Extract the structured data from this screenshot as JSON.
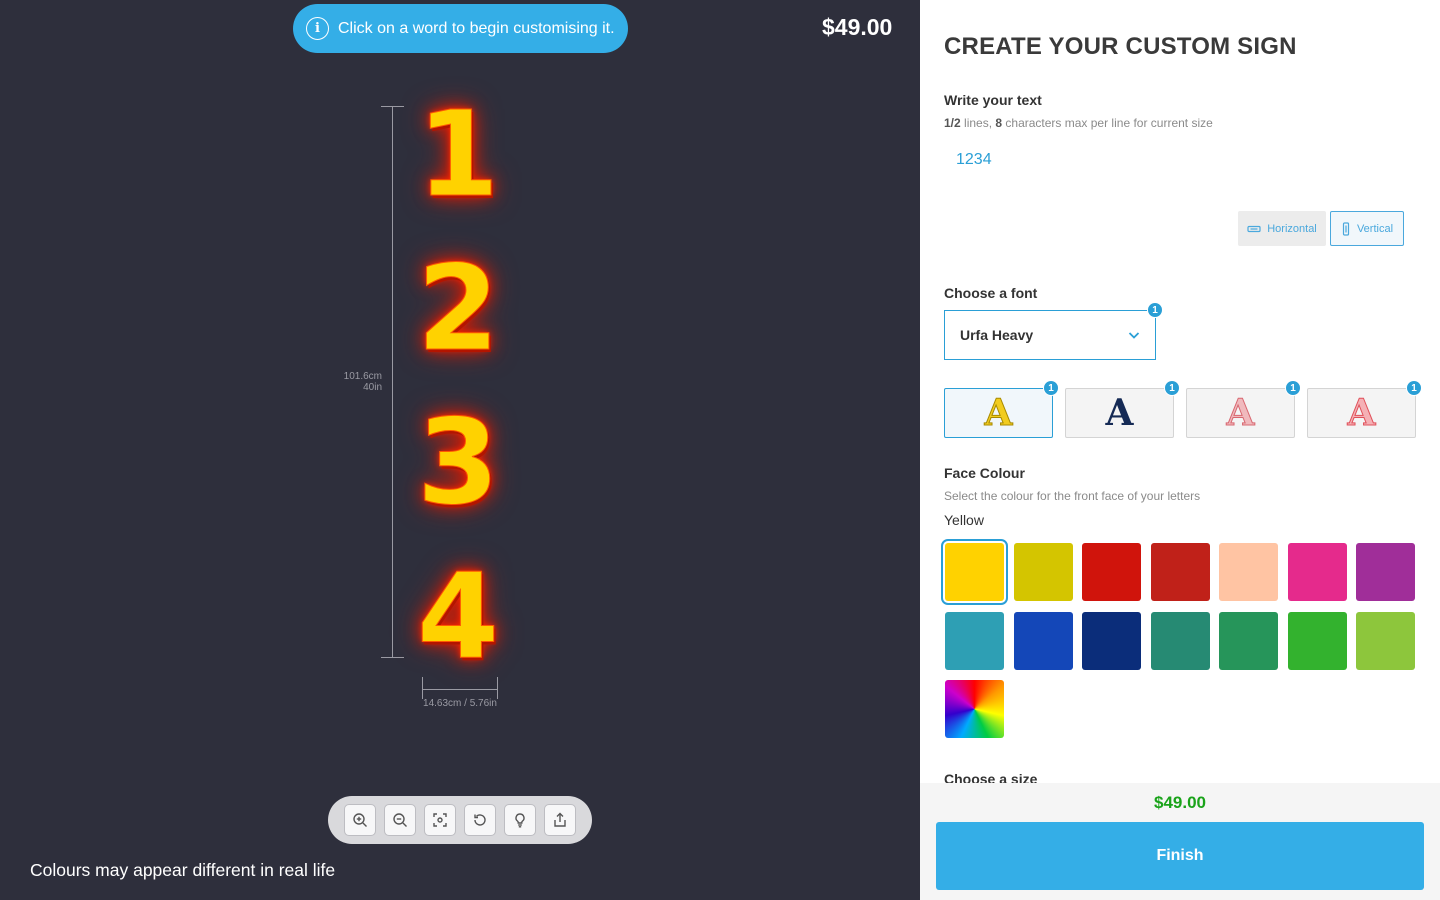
{
  "preview": {
    "hint_text": "Click on a word to begin customising it.",
    "info_icon": "i",
    "price": "$49.00",
    "sign_chars": [
      "1",
      "2",
      "3",
      "4"
    ],
    "height_cm": "101.6cm",
    "height_in": "40in",
    "width_label": "14.63cm / 5.76in",
    "disclaimer": "Colours may appear different in real life",
    "toolbar_icons": [
      "zoom-in-icon",
      "zoom-out-icon",
      "focus-icon",
      "rotate-icon",
      "lightbulb-icon",
      "share-icon"
    ]
  },
  "panel": {
    "title": "CREATE YOUR CUSTOM SIGN",
    "write_text": {
      "label": "Write your text",
      "lines_count": "1/2",
      "lines_text": " lines, ",
      "chars_count": "8",
      "chars_text": " characters max per line for current size",
      "value": "1234"
    },
    "orientation": {
      "horizontal": "Horizontal",
      "vertical": "Vertical",
      "selected": "Vertical"
    },
    "font": {
      "label": "Choose a font",
      "selected": "Urfa Heavy",
      "badge": "1"
    },
    "styles": [
      {
        "glyph": "A",
        "badge": "1",
        "color": "#f2cc1f",
        "selected": true
      },
      {
        "glyph": "A",
        "badge": "1",
        "color": "#152a55",
        "selected": false
      },
      {
        "glyph": "A",
        "badge": "1",
        "color": "#f0b9bd",
        "selected": false
      },
      {
        "glyph": "A",
        "badge": "1",
        "color": "#f5b0b5",
        "selected": false
      }
    ],
    "face_colour": {
      "label": "Face Colour",
      "sub": "Select the colour for the front face of your letters",
      "selected": "Yellow",
      "swatches": [
        "#ffd200",
        "#d4c500",
        "#d0140c",
        "#c02119",
        "#ffc4a3",
        "#e52a8c",
        "#a02e99",
        "#2e9fb4",
        "#1447b8",
        "#0b2d7a",
        "#268a73",
        "#26955a",
        "#33b22e",
        "#8dc63c",
        "rainbow"
      ]
    },
    "size": {
      "label": "Choose a size"
    },
    "footer": {
      "price": "$49.00",
      "finish": "Finish"
    }
  }
}
